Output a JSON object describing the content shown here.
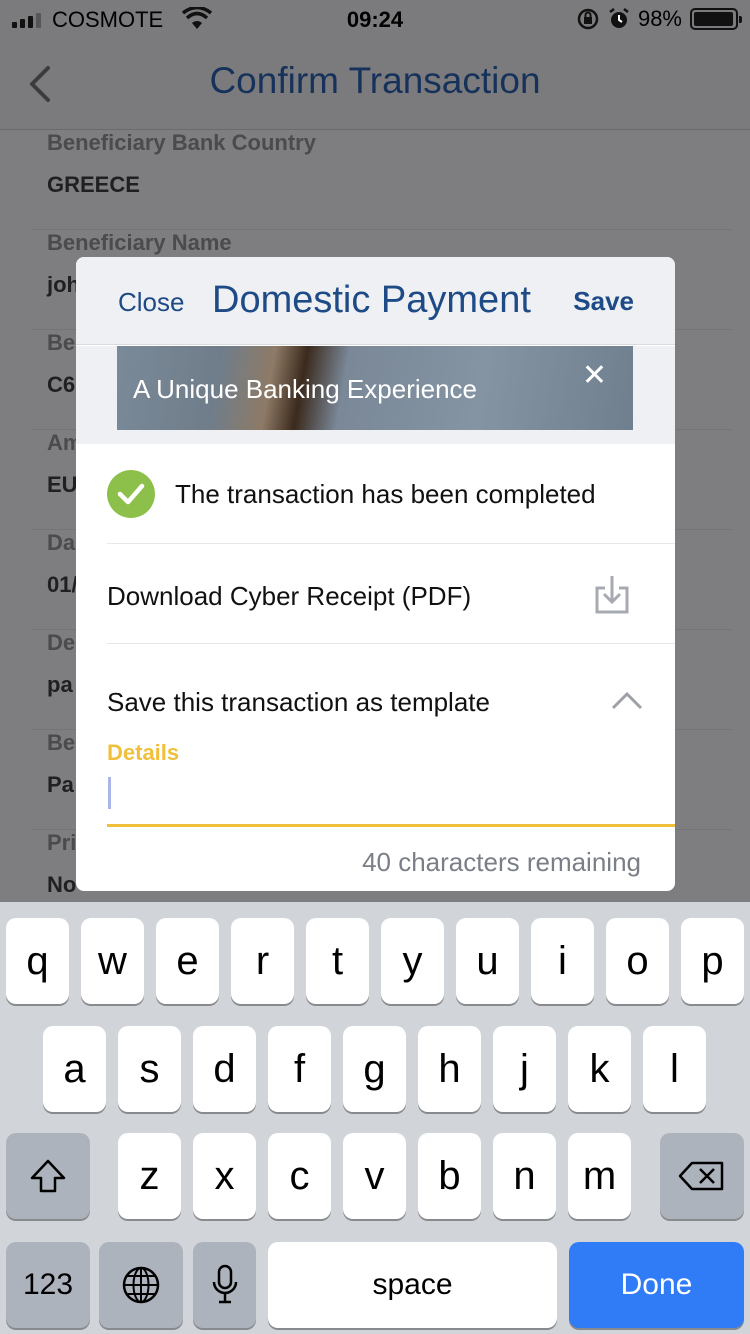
{
  "status_bar": {
    "carrier": "COSMOTE",
    "time": "09:24",
    "battery": "98%",
    "battery_level": 0.98,
    "icons": [
      "signal-icon",
      "wifi-icon",
      "orientation-lock-icon",
      "alarm-icon",
      "battery-icon"
    ]
  },
  "nav": {
    "title": "Confirm Transaction",
    "back_icon": "chevron-left-icon"
  },
  "background_fields": [
    {
      "label": "Beneficiary Bank Country",
      "value": "GREECE"
    },
    {
      "label": "Beneficiary Name",
      "value": "joh"
    },
    {
      "label": "Be",
      "value": "C6"
    },
    {
      "label": "Am",
      "value": "EU"
    },
    {
      "label": "Da",
      "value": "01/"
    },
    {
      "label": "De",
      "value": "pa"
    },
    {
      "label": "Be",
      "value": "Pa"
    },
    {
      "label": "Pri",
      "value": "No"
    }
  ],
  "modal": {
    "close_label": "Close",
    "title": "Domestic Payment",
    "save_label": "Save",
    "banner_text": "A Unique Banking Experience",
    "banner_close_icon": "close-icon",
    "status_text": "The transaction has been completed",
    "status_icon": "checkmark-circle-icon",
    "download_label": "Download Cyber Receipt (PDF)",
    "download_icon": "download-icon",
    "template_label": "Save this transaction as template",
    "template_icon": "chevron-up-icon",
    "details_label": "Details",
    "details_value": "",
    "remaining_text": "40 characters remaining",
    "colors": {
      "accent": "#f0c03c",
      "primary": "#1e4a86",
      "success": "#8dc04a"
    }
  },
  "keyboard": {
    "row1": [
      "q",
      "w",
      "e",
      "r",
      "t",
      "y",
      "u",
      "i",
      "o",
      "p"
    ],
    "row2": [
      "a",
      "s",
      "d",
      "f",
      "g",
      "h",
      "j",
      "k",
      "l"
    ],
    "row3": [
      "z",
      "x",
      "c",
      "v",
      "b",
      "n",
      "m"
    ],
    "numbers_label": "123",
    "space_label": "space",
    "done_label": "Done",
    "icons": [
      "shift-icon",
      "backspace-icon",
      "globe-icon",
      "microphone-icon"
    ]
  }
}
